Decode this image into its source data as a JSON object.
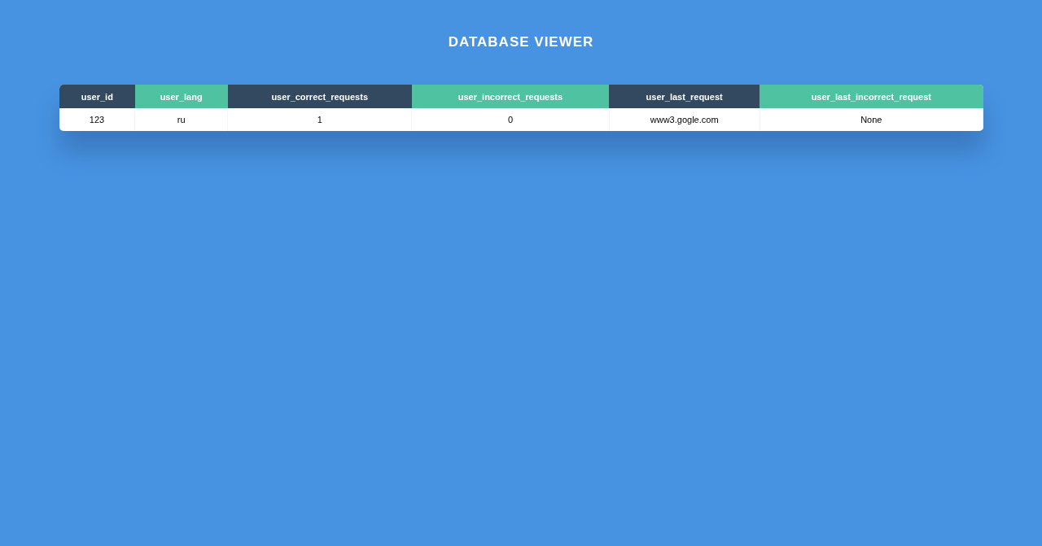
{
  "title": "DATABASE VIEWER",
  "table": {
    "columns": [
      {
        "label": "user_id",
        "color": "#324960"
      },
      {
        "label": "user_lang",
        "color": "#4fc3a1"
      },
      {
        "label": "user_correct_requests",
        "color": "#324960"
      },
      {
        "label": "user_incorrect_requests",
        "color": "#4fc3a1"
      },
      {
        "label": "user_last_request",
        "color": "#324960"
      },
      {
        "label": "user_last_incorrect_request",
        "color": "#4fc3a1"
      }
    ],
    "rows": [
      [
        "123",
        "ru",
        "1",
        "0",
        "www3.gogle.com",
        "None"
      ]
    ]
  }
}
